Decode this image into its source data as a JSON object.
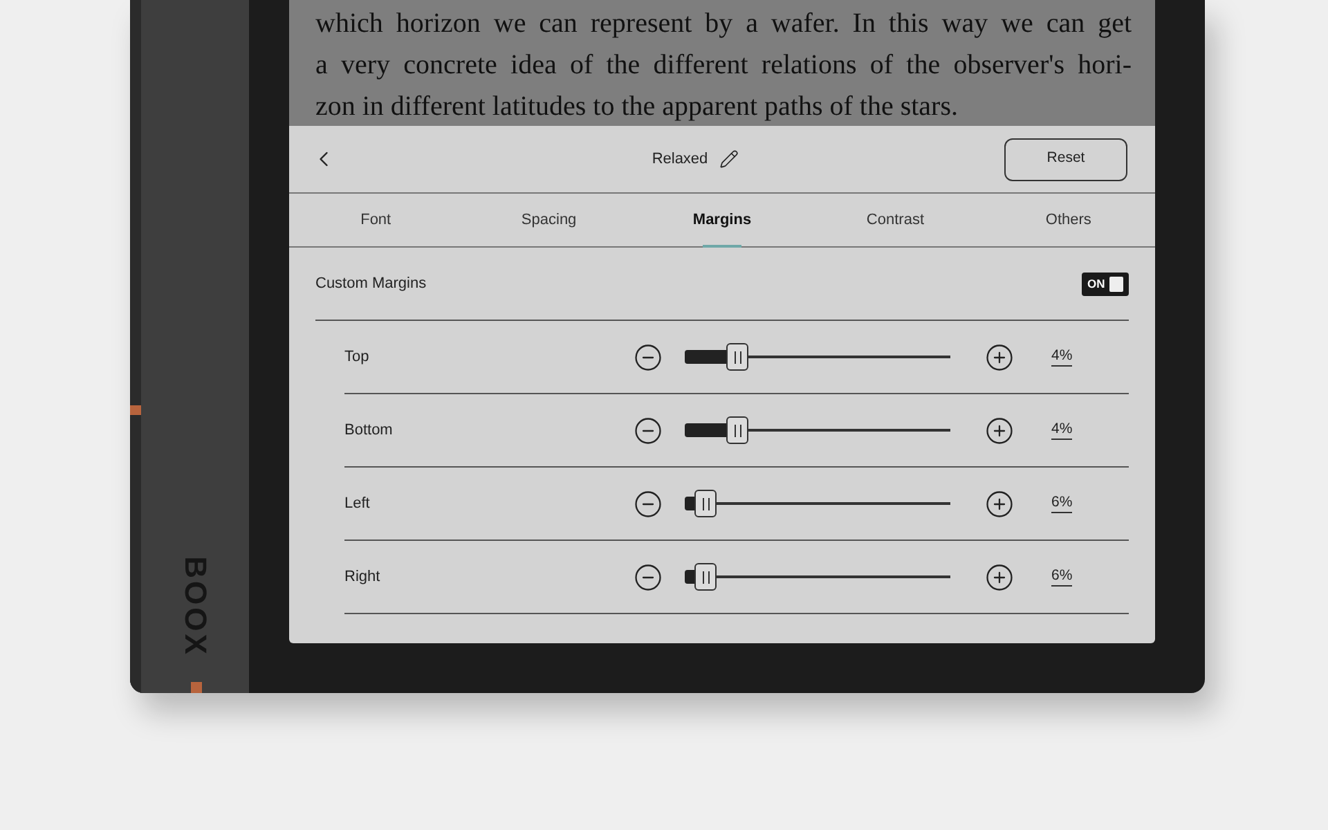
{
  "device": {
    "brand": "BOOX"
  },
  "book_text": {
    "lines": [
      "which horizon we can represent by a wafer. In this way we can get",
      "a very concrete idea of the different relations of the observer's hori-",
      "zon in different latitudes to the apparent paths of the stars."
    ]
  },
  "header": {
    "title": "Relaxed",
    "reset_button": "Reset"
  },
  "tabs": [
    {
      "label": "Font",
      "selected": false
    },
    {
      "label": "Spacing",
      "selected": false
    },
    {
      "label": "Margins",
      "selected": true
    },
    {
      "label": "Contrast",
      "selected": false
    },
    {
      "label": "Others",
      "selected": false
    }
  ],
  "custom_margins": {
    "label": "Custom Margins",
    "on": true,
    "state_label": "ON"
  },
  "margins": [
    {
      "name": "Top",
      "level": 0.2,
      "reading": "4%"
    },
    {
      "name": "Bottom",
      "level": 0.2,
      "reading": "4%"
    },
    {
      "name": "Left",
      "level": 0.08,
      "reading": "6%"
    },
    {
      "name": "Right",
      "level": 0.08,
      "reading": "6%"
    }
  ]
}
